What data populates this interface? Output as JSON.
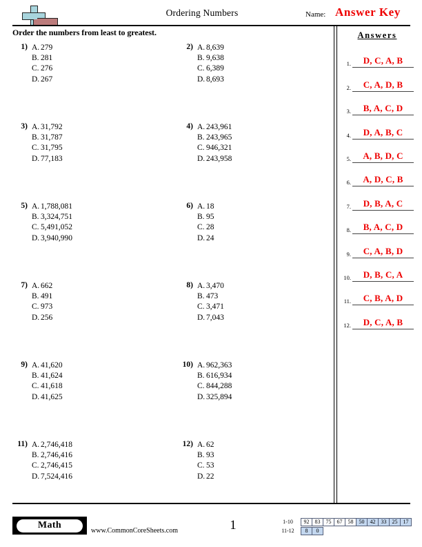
{
  "header": {
    "title": "Ordering Numbers",
    "name_label": "Name:",
    "answer_key": "Answer Key",
    "logo_icon": "plus-block-logo",
    "logo_plus_color": "#a8d5dd",
    "logo_bar_color": "#bb7b7b"
  },
  "instruction": "Order the numbers from least to greatest.",
  "questions": [
    {
      "number": "1)",
      "choices": [
        {
          "label": "A.",
          "value": "279"
        },
        {
          "label": "B.",
          "value": "281"
        },
        {
          "label": "C.",
          "value": "276"
        },
        {
          "label": "D.",
          "value": "267"
        }
      ]
    },
    {
      "number": "2)",
      "choices": [
        {
          "label": "A.",
          "value": "8,639"
        },
        {
          "label": "B.",
          "value": "9,638"
        },
        {
          "label": "C.",
          "value": "6,389"
        },
        {
          "label": "D.",
          "value": "8,693"
        }
      ]
    },
    {
      "number": "3)",
      "choices": [
        {
          "label": "A.",
          "value": "31,792"
        },
        {
          "label": "B.",
          "value": "31,787"
        },
        {
          "label": "C.",
          "value": "31,795"
        },
        {
          "label": "D.",
          "value": "77,183"
        }
      ]
    },
    {
      "number": "4)",
      "choices": [
        {
          "label": "A.",
          "value": "243,961"
        },
        {
          "label": "B.",
          "value": "243,965"
        },
        {
          "label": "C.",
          "value": "946,321"
        },
        {
          "label": "D.",
          "value": "243,958"
        }
      ]
    },
    {
      "number": "5)",
      "choices": [
        {
          "label": "A.",
          "value": "1,788,081"
        },
        {
          "label": "B.",
          "value": "3,324,751"
        },
        {
          "label": "C.",
          "value": "5,491,052"
        },
        {
          "label": "D.",
          "value": "3,940,990"
        }
      ]
    },
    {
      "number": "6)",
      "choices": [
        {
          "label": "A.",
          "value": "18"
        },
        {
          "label": "B.",
          "value": "95"
        },
        {
          "label": "C.",
          "value": "28"
        },
        {
          "label": "D.",
          "value": "24"
        }
      ]
    },
    {
      "number": "7)",
      "choices": [
        {
          "label": "A.",
          "value": "662"
        },
        {
          "label": "B.",
          "value": "491"
        },
        {
          "label": "C.",
          "value": "973"
        },
        {
          "label": "D.",
          "value": "256"
        }
      ]
    },
    {
      "number": "8)",
      "choices": [
        {
          "label": "A.",
          "value": "3,470"
        },
        {
          "label": "B.",
          "value": "473"
        },
        {
          "label": "C.",
          "value": "3,471"
        },
        {
          "label": "D.",
          "value": "7,043"
        }
      ]
    },
    {
      "number": "9)",
      "choices": [
        {
          "label": "A.",
          "value": "41,620"
        },
        {
          "label": "B.",
          "value": "41,624"
        },
        {
          "label": "C.",
          "value": "41,618"
        },
        {
          "label": "D.",
          "value": "41,625"
        }
      ]
    },
    {
      "number": "10)",
      "choices": [
        {
          "label": "A.",
          "value": "962,363"
        },
        {
          "label": "B.",
          "value": "616,934"
        },
        {
          "label": "C.",
          "value": "844,288"
        },
        {
          "label": "D.",
          "value": "325,894"
        }
      ]
    },
    {
      "number": "11)",
      "choices": [
        {
          "label": "A.",
          "value": "2,746,418"
        },
        {
          "label": "B.",
          "value": "2,746,416"
        },
        {
          "label": "C.",
          "value": "2,746,415"
        },
        {
          "label": "D.",
          "value": "7,524,416"
        }
      ]
    },
    {
      "number": "12)",
      "choices": [
        {
          "label": "A.",
          "value": "62"
        },
        {
          "label": "B.",
          "value": "93"
        },
        {
          "label": "C.",
          "value": "53"
        },
        {
          "label": "D.",
          "value": "22"
        }
      ]
    }
  ],
  "answers": {
    "title": "Answers",
    "color": "#ee0000",
    "items": [
      {
        "number": "1.",
        "value": "D, C, A, B"
      },
      {
        "number": "2.",
        "value": "C, A, D, B"
      },
      {
        "number": "3.",
        "value": "B, A, C, D"
      },
      {
        "number": "4.",
        "value": "D, A, B, C"
      },
      {
        "number": "5.",
        "value": "A, B, D, C"
      },
      {
        "number": "6.",
        "value": "A, D, C, B"
      },
      {
        "number": "7.",
        "value": "D, B, A, C"
      },
      {
        "number": "8.",
        "value": "B, A, C, D"
      },
      {
        "number": "9.",
        "value": "C, A, B, D"
      },
      {
        "number": "10.",
        "value": "D, B, C, A"
      },
      {
        "number": "11.",
        "value": "C, B, A, D"
      },
      {
        "number": "12.",
        "value": "D, C, A, B"
      }
    ]
  },
  "footer": {
    "subject_badge": "Math",
    "site_url": "www.CommonCoreSheets.com",
    "page_number": "1",
    "score_table": {
      "shaded_color": "#c3d7ef",
      "rows": [
        {
          "label": "1-10",
          "cells": [
            {
              "value": "92",
              "shaded": false
            },
            {
              "value": "83",
              "shaded": false
            },
            {
              "value": "75",
              "shaded": false
            },
            {
              "value": "67",
              "shaded": false
            },
            {
              "value": "58",
              "shaded": false
            },
            {
              "value": "50",
              "shaded": true
            },
            {
              "value": "42",
              "shaded": true
            },
            {
              "value": "33",
              "shaded": true
            },
            {
              "value": "25",
              "shaded": true
            },
            {
              "value": "17",
              "shaded": true
            }
          ]
        },
        {
          "label": "11-12",
          "cells": [
            {
              "value": "8",
              "shaded": true
            },
            {
              "value": "0",
              "shaded": true
            }
          ]
        }
      ]
    }
  }
}
